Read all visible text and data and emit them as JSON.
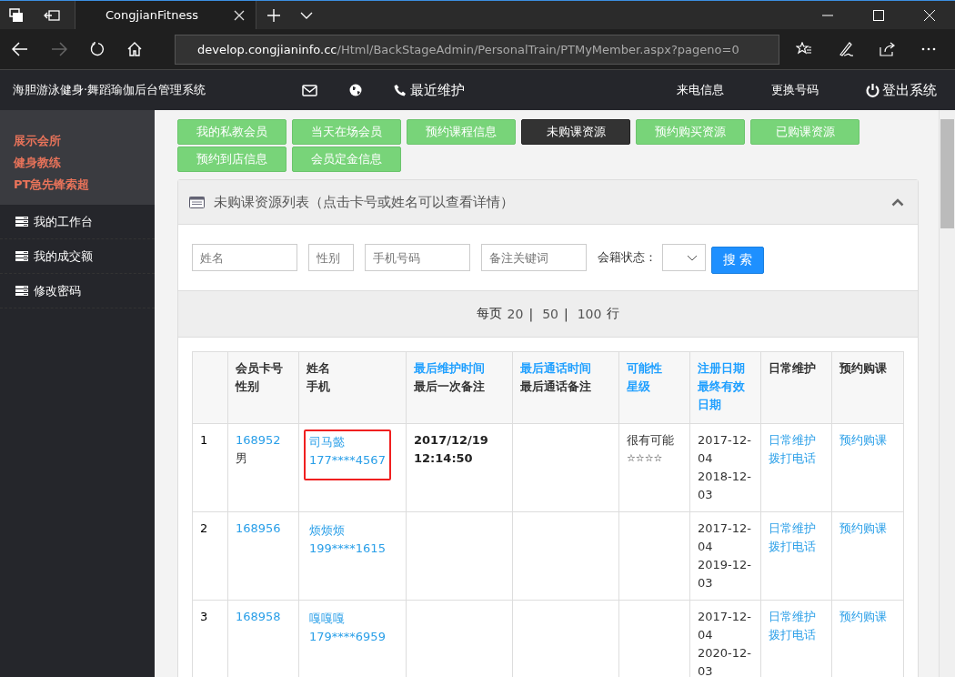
{
  "browser": {
    "tab_title": "CongjianFitness",
    "url_domain": "develop.congjianinfo.cc",
    "url_path": "/Html/BackStageAdmin/PersonalTrain/PTMyMember.aspx?pageno=0"
  },
  "header": {
    "title": "海胆游泳健身·舞蹈瑜伽后台管理系统",
    "recent": "最近维护",
    "links": [
      "来电信息",
      "更换号码"
    ],
    "logout": "登出系统"
  },
  "sidebar": {
    "profile": [
      "展示会所",
      "健身教练",
      "PT急先锋索超"
    ],
    "items": [
      {
        "label": "我的工作台"
      },
      {
        "label": "我的成交额"
      },
      {
        "label": "修改密码"
      }
    ]
  },
  "nav_buttons": [
    {
      "label": "我的私教会员",
      "selected": false
    },
    {
      "label": "当天在场会员",
      "selected": false
    },
    {
      "label": "预约课程信息",
      "selected": false
    },
    {
      "label": "未购课资源",
      "selected": true
    },
    {
      "label": "预约购买资源",
      "selected": false
    },
    {
      "label": "已购课资源",
      "selected": false
    },
    {
      "label": "预约到店信息",
      "selected": false
    },
    {
      "label": "会员定金信息",
      "selected": false
    }
  ],
  "panel": {
    "title": "未购课资源列表（点击卡号或姓名可以查看详情）",
    "filters": {
      "name_placeholder": "姓名",
      "gender_placeholder": "性别",
      "phone_placeholder": "手机号码",
      "note_placeholder": "备注关键词",
      "status_label": "会籍状态：",
      "search_button": "搜 索"
    },
    "per_page": {
      "label": "每页",
      "options": [
        "20",
        "50",
        "100"
      ],
      "separator": "|",
      "unit": "行"
    },
    "table": {
      "columns": [
        {},
        {
          "lines": [
            {
              "text": "会员卡号",
              "link": false
            },
            {
              "text": "性别",
              "link": false
            }
          ]
        },
        {
          "lines": [
            {
              "text": "姓名",
              "link": false
            },
            {
              "text": "手机",
              "link": false
            }
          ]
        },
        {
          "lines": [
            {
              "text": "最后维护时间",
              "link": true
            },
            {
              "text": "最后一次备注",
              "link": false
            }
          ]
        },
        {
          "lines": [
            {
              "text": "最后通话时间",
              "link": true
            },
            {
              "text": "最后通话备注",
              "link": false
            }
          ]
        },
        {
          "lines": [
            {
              "text": "可能性",
              "link": true
            },
            {
              "text": "星级",
              "link": true
            }
          ]
        },
        {
          "lines": [
            {
              "text": "注册日期",
              "link": true
            },
            {
              "text": "最终有效日期",
              "link": true
            }
          ]
        },
        {
          "lines": [
            {
              "text": "日常维护",
              "link": false
            }
          ]
        },
        {
          "lines": [
            {
              "text": "预约购课",
              "link": false
            }
          ]
        }
      ],
      "rows": [
        {
          "index": "1",
          "card": "168952",
          "gender": "男",
          "name": "司马懿",
          "phone": "177****4567",
          "highlighted": true,
          "last_maintain": "2017/12/19 12:14:50",
          "possibility": "很有可能",
          "stars_text": "☆☆☆☆",
          "reg_date": "2017-12-04",
          "expiry_date": "2018-12-03",
          "maintain_link": "日常维护",
          "call_link": "拨打电话",
          "book_link": "预约购课"
        },
        {
          "index": "2",
          "card": "168956",
          "name": "烦烦烦",
          "phone": "199****1615",
          "highlighted": false,
          "reg_date": "2017-12-04",
          "expiry_date": "2019-12-03",
          "maintain_link": "日常维护",
          "call_link": "拨打电话",
          "book_link": "预约购课"
        },
        {
          "index": "3",
          "card": "168958",
          "name": "嘎嘎嘎",
          "phone": "179****6959",
          "highlighted": false,
          "reg_date": "2017-12-04",
          "expiry_date": "2020-12-03",
          "maintain_link": "日常维护",
          "call_link": "拨打电话",
          "book_link": "预约购课"
        }
      ]
    }
  }
}
